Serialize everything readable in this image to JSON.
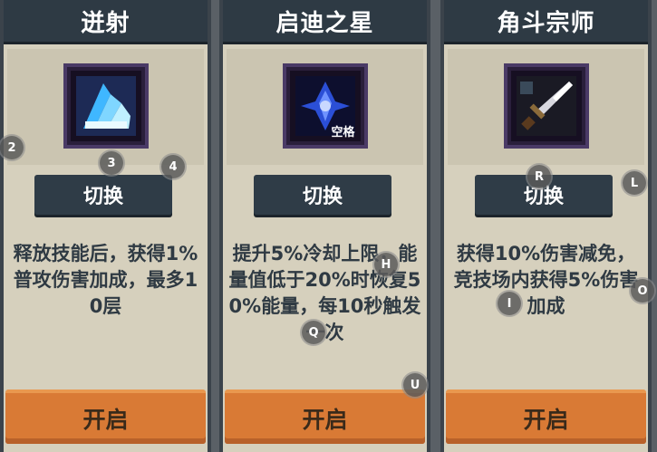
{
  "cards": [
    {
      "title": "迸射",
      "icon": "burst-blade-icon",
      "switch_label": "切换",
      "description": "释放技能后，获得1%普攻伤害加成，最多10层",
      "open_label": "开启"
    },
    {
      "title": "启迪之星",
      "icon": "blue-star-gem-icon",
      "key_label": "空格",
      "switch_label": "切换",
      "description": "提升5%冷却上限，能量值低于20%时恢复50%能量，每10秒触发一次",
      "open_label": "开启"
    },
    {
      "title": "角斗宗师",
      "icon": "sword-icon",
      "switch_label": "切换",
      "description": "获得10%伤害减免，竞技场内获得5%伤害加成",
      "open_label": "开启"
    }
  ],
  "hotkeys": {
    "k2": "2",
    "k3": "3",
    "k4": "4",
    "kR": "R",
    "kL": "L",
    "kH": "H",
    "kI": "I",
    "kO": "O",
    "kQ": "Q",
    "kU": "U"
  },
  "colors": {
    "title_bar": "#2e3a44",
    "card_bg": "#d6d0bd",
    "open_button": "#d97a35",
    "text": "#2f3a43"
  }
}
